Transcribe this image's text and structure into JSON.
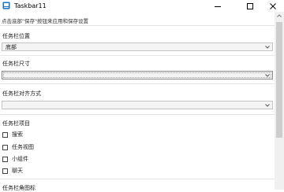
{
  "window": {
    "title": "Taskbar11",
    "icon": "app-window-icon",
    "controls": [
      "minimize-icon",
      "maximize-icon",
      "close-icon"
    ]
  },
  "hint": "点击底部\"保存\"按钮来应用和保存设置",
  "sections": {
    "position": {
      "label": "任务栏位置",
      "value": "底部"
    },
    "size": {
      "label": "任务栏尺寸",
      "value": ""
    },
    "alignment": {
      "label": "任务栏对齐方式",
      "value": ""
    },
    "items": {
      "label": "任务栏项目",
      "options": [
        {
          "label": "搜索",
          "checked": false
        },
        {
          "label": "任务视图",
          "checked": false
        },
        {
          "label": "小组件",
          "checked": false
        },
        {
          "label": "聊天",
          "checked": false
        }
      ]
    },
    "icons": {
      "label": "任务栏角图标"
    }
  },
  "colors": {
    "accent": "#1e73c6",
    "background": "#ffffff",
    "scrollbar_thumb": "#cdcdcd"
  }
}
